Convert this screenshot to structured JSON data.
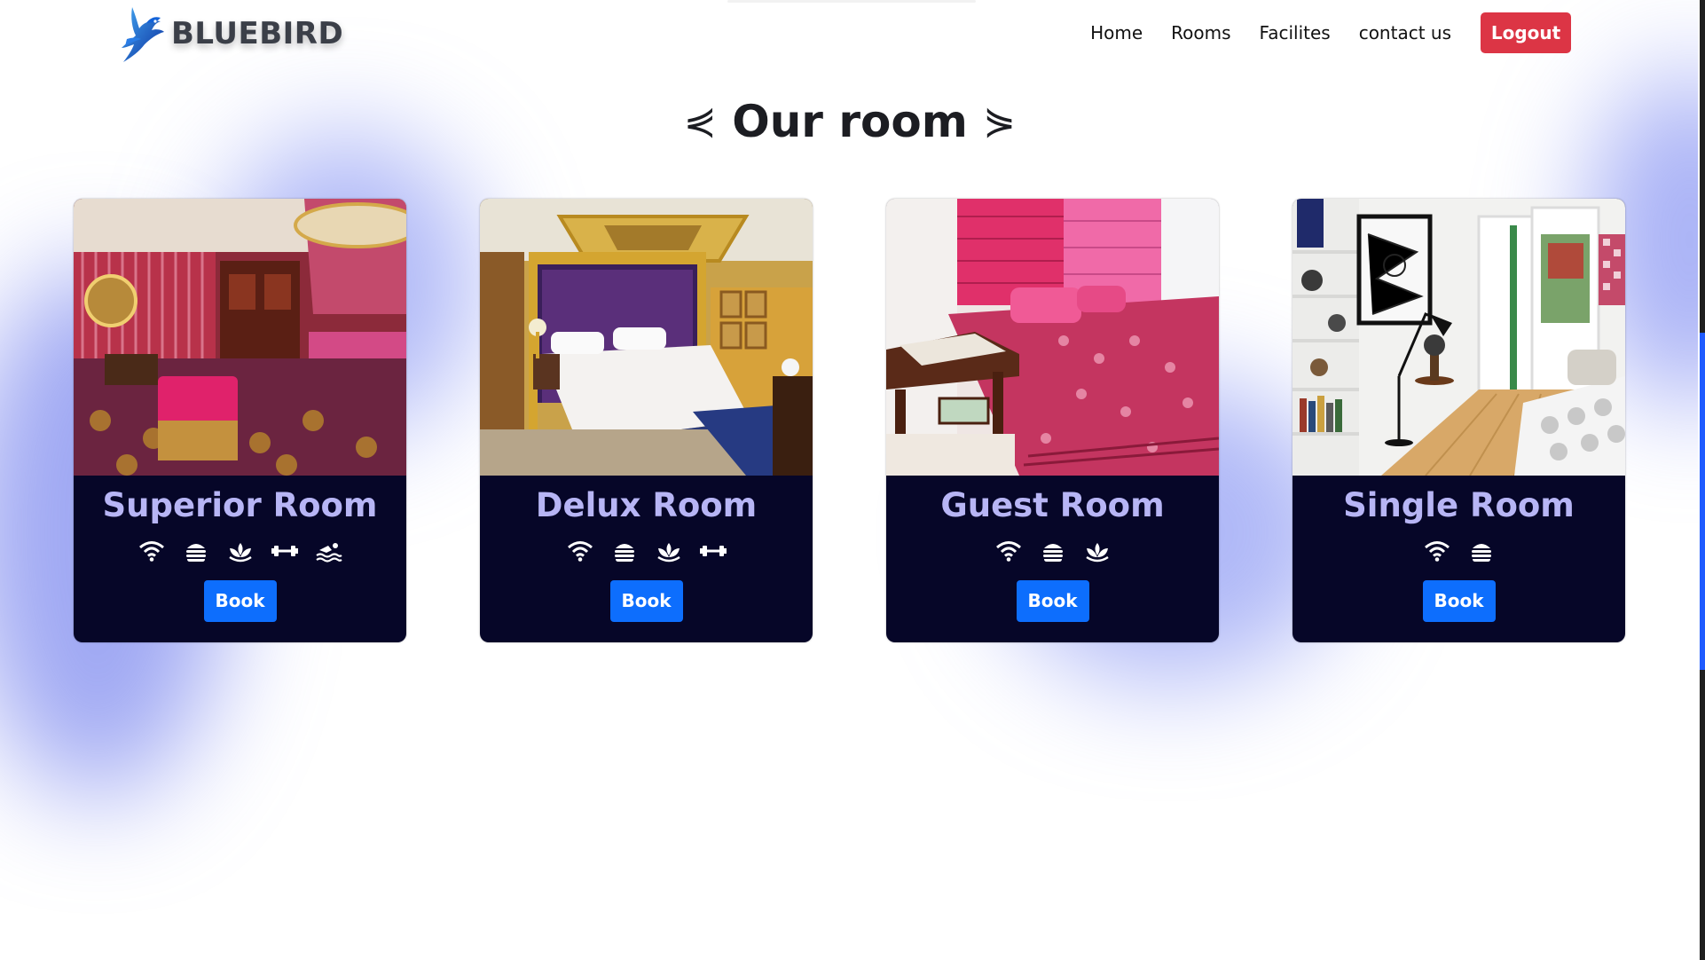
{
  "brand": {
    "name": "BLUEBIRD",
    "logo_icon": "bluebird-logo-icon"
  },
  "nav": {
    "items": [
      "Home",
      "Rooms",
      "Facilites",
      "contact us"
    ],
    "logout_label": "Logout"
  },
  "section": {
    "title": "Our room",
    "deco_left": "⋞",
    "deco_right": "⋟"
  },
  "rooms": [
    {
      "name": "Superior Room",
      "amenities": [
        "wifi-icon",
        "burger-icon",
        "spa-icon",
        "dumbbell-icon",
        "swimmer-icon"
      ],
      "book_label": "Book"
    },
    {
      "name": "Delux Room",
      "amenities": [
        "wifi-icon",
        "burger-icon",
        "spa-icon",
        "dumbbell-icon"
      ],
      "book_label": "Book"
    },
    {
      "name": "Guest Room",
      "amenities": [
        "wifi-icon",
        "burger-icon",
        "spa-icon"
      ],
      "book_label": "Book"
    },
    {
      "name": "Single Room",
      "amenities": [
        "wifi-icon",
        "burger-icon"
      ],
      "book_label": "Book"
    }
  ],
  "colors": {
    "card_bg": "#060628",
    "room_name": "#b7b5f5",
    "book_button": "#0d6efd",
    "logout_button": "#dc3545",
    "blob": "#6473eb"
  }
}
